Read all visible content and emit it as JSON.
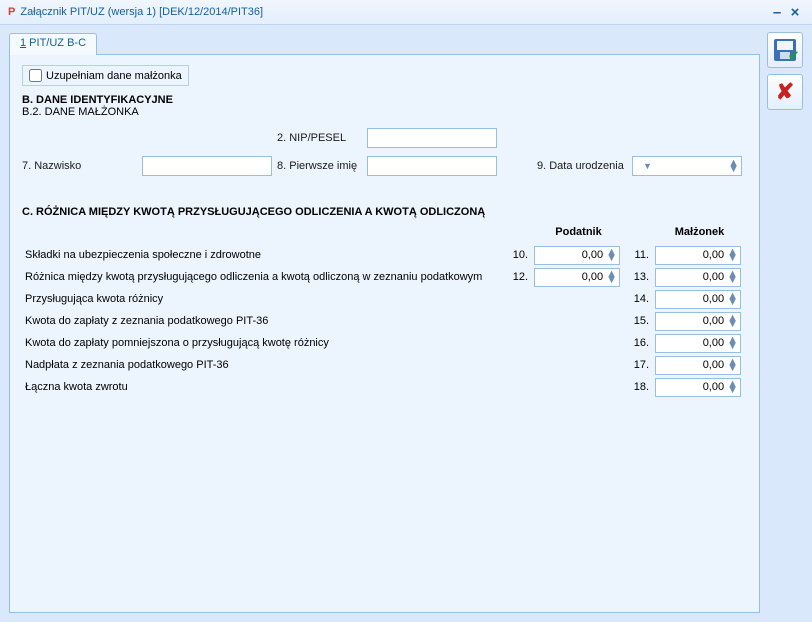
{
  "window": {
    "title": "Załącznik PIT/UZ (wersja 1) [DEK/12/2014/PIT36]"
  },
  "tab": {
    "prefix": "1",
    "rest": " PIT/UZ B-C"
  },
  "spouse_check_label": "Uzupełniam dane małżonka",
  "sectB": {
    "title": "B. DANE IDENTYFIKACYJNE",
    "sub": "B.2. DANE MAŁŻONKA"
  },
  "fields": {
    "nip_label": "2. NIP/PESEL",
    "nazw_label": "7. Nazwisko",
    "imie_label": "8. Pierwsze imię",
    "data_label": "9. Data urodzenia"
  },
  "sectC": {
    "title": "C. RÓŻNICA MIĘDZY KWOTĄ PRZYSŁUGUJĄCEGO ODLICZENIA A KWOTĄ ODLICZONĄ",
    "col_pod": "Podatnik",
    "col_mal": "Małżonek",
    "rows": [
      {
        "desc": "Składki na ubezpieczenia społeczne i zdrowotne",
        "p_no": "10.",
        "p_val": "0,00",
        "m_no": "11.",
        "m_val": "0,00"
      },
      {
        "desc": "Różnica między kwotą przysługującego odliczenia a kwotą odliczoną w zeznaniu podatkowym",
        "p_no": "12.",
        "p_val": "0,00",
        "m_no": "13.",
        "m_val": "0,00"
      },
      {
        "desc": "Przysługująca kwota różnicy",
        "p_no": "",
        "p_val": "",
        "m_no": "14.",
        "m_val": "0,00"
      },
      {
        "desc": "Kwota do zapłaty z zeznania podatkowego PIT-36",
        "p_no": "",
        "p_val": "",
        "m_no": "15.",
        "m_val": "0,00"
      },
      {
        "desc": "Kwota do zapłaty pomniejszona o przysługującą kwotę różnicy",
        "p_no": "",
        "p_val": "",
        "m_no": "16.",
        "m_val": "0,00"
      },
      {
        "desc": "Nadpłata z zeznania podatkowego PIT-36",
        "p_no": "",
        "p_val": "",
        "m_no": "17.",
        "m_val": "0,00"
      },
      {
        "desc": "Łączna kwota zwrotu",
        "p_no": "",
        "p_val": "",
        "m_no": "18.",
        "m_val": "0,00"
      }
    ]
  }
}
